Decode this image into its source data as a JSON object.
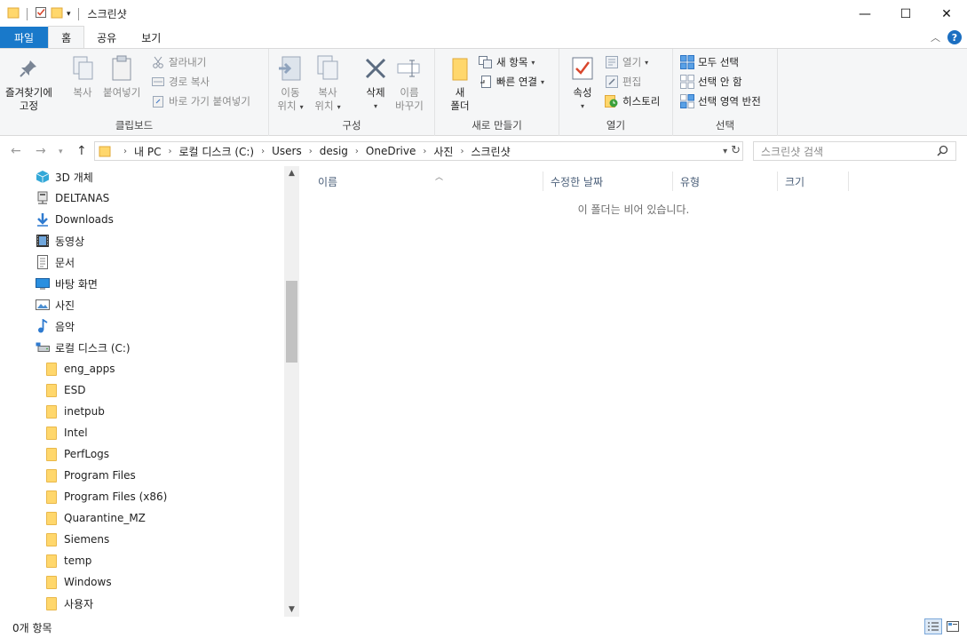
{
  "window": {
    "title": "스크린샷",
    "minimize": "—",
    "maximize": "☐",
    "close": "✕"
  },
  "ribbon_tabs": [
    {
      "label": "파일"
    },
    {
      "label": "홈"
    },
    {
      "label": "공유"
    },
    {
      "label": "보기"
    }
  ],
  "clipboard": {
    "pin_label_1": "즐겨찾기에",
    "pin_label_2": "고정",
    "copy": "복사",
    "paste": "붙여넣기",
    "cut": "잘라내기",
    "copy_path": "경로 복사",
    "paste_shortcut": "바로 가기 붙여넣기",
    "group": "클립보드"
  },
  "organize": {
    "move_1": "이동",
    "move_2": "위치",
    "copyto_1": "복사",
    "copyto_2": "위치",
    "delete": "삭제",
    "rename_1": "이름",
    "rename_2": "바꾸기",
    "group": "구성"
  },
  "new": {
    "new_folder_1": "새",
    "new_folder_2": "폴더",
    "new_item": "새 항목",
    "easy_access": "빠른 연결",
    "group": "새로 만들기"
  },
  "open": {
    "properties": "속성",
    "open": "열기",
    "edit": "편집",
    "history": "히스토리",
    "group": "열기"
  },
  "select": {
    "select_all": "모두 선택",
    "select_none": "선택 안 함",
    "invert": "선택 영역 반전",
    "group": "선택"
  },
  "address": {
    "crumbs": [
      "내 PC",
      "로컬 디스크 (C:)",
      "Users",
      "desig",
      "OneDrive",
      "사진",
      "스크린샷"
    ],
    "search_placeholder": "스크린샷 검색"
  },
  "nav_items": [
    {
      "label": "3D 개체",
      "icon": "cube-3d-icon"
    },
    {
      "label": "DELTANAS",
      "icon": "network-drive-icon"
    },
    {
      "label": "Downloads",
      "icon": "download-icon"
    },
    {
      "label": "동영상",
      "icon": "video-icon"
    },
    {
      "label": "문서",
      "icon": "document-icon"
    },
    {
      "label": "바탕 화면",
      "icon": "desktop-icon"
    },
    {
      "label": "사진",
      "icon": "pictures-icon"
    },
    {
      "label": "음악",
      "icon": "music-icon"
    },
    {
      "label": "로컬 디스크 (C:)",
      "icon": "drive-icon"
    },
    {
      "label": "eng_apps",
      "icon": "folder-icon"
    },
    {
      "label": "ESD",
      "icon": "folder-icon"
    },
    {
      "label": "inetpub",
      "icon": "folder-icon"
    },
    {
      "label": "Intel",
      "icon": "folder-icon"
    },
    {
      "label": "PerfLogs",
      "icon": "folder-icon"
    },
    {
      "label": "Program Files",
      "icon": "folder-icon"
    },
    {
      "label": "Program Files (x86)",
      "icon": "folder-icon"
    },
    {
      "label": "Quarantine_MZ",
      "icon": "folder-icon"
    },
    {
      "label": "Siemens",
      "icon": "folder-icon"
    },
    {
      "label": "temp",
      "icon": "folder-icon"
    },
    {
      "label": "Windows",
      "icon": "folder-icon"
    },
    {
      "label": "사용자",
      "icon": "folder-icon"
    }
  ],
  "columns": [
    {
      "label": "이름"
    },
    {
      "label": "수정한 날짜"
    },
    {
      "label": "유형"
    },
    {
      "label": "크기"
    }
  ],
  "empty_message": "이 폴더는 비어 있습니다.",
  "status": {
    "item_count": "0개 항목"
  }
}
